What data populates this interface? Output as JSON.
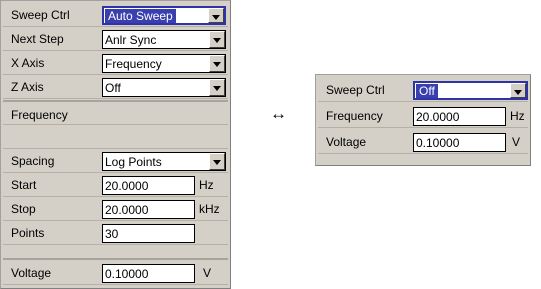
{
  "left_panel": {
    "sweep_ctrl": {
      "label": "Sweep Ctrl",
      "value": "Auto Sweep"
    },
    "next_step": {
      "label": "Next Step",
      "value": "Anlr Sync"
    },
    "x_axis": {
      "label": "X Axis",
      "value": "Frequency"
    },
    "z_axis": {
      "label": "Z Axis",
      "value": "Off"
    },
    "frequency_header": "Frequency",
    "spacing": {
      "label": "Spacing",
      "value": "Log Points"
    },
    "start": {
      "label": "Start",
      "value": "20.0000",
      "unit": "Hz"
    },
    "stop": {
      "label": "Stop",
      "value": "20.0000",
      "unit": "kHz"
    },
    "points": {
      "label": "Points",
      "value": "30"
    },
    "voltage": {
      "label": "Voltage",
      "value": "0.10000",
      "unit": "V"
    }
  },
  "swap_icon": "↔",
  "right_panel": {
    "sweep_ctrl": {
      "label": "Sweep Ctrl",
      "value": "Off"
    },
    "frequency": {
      "label": "Frequency",
      "value": "20.0000",
      "unit": "Hz"
    },
    "voltage": {
      "label": "Voltage",
      "value": "0.10000",
      "unit": "V"
    }
  }
}
